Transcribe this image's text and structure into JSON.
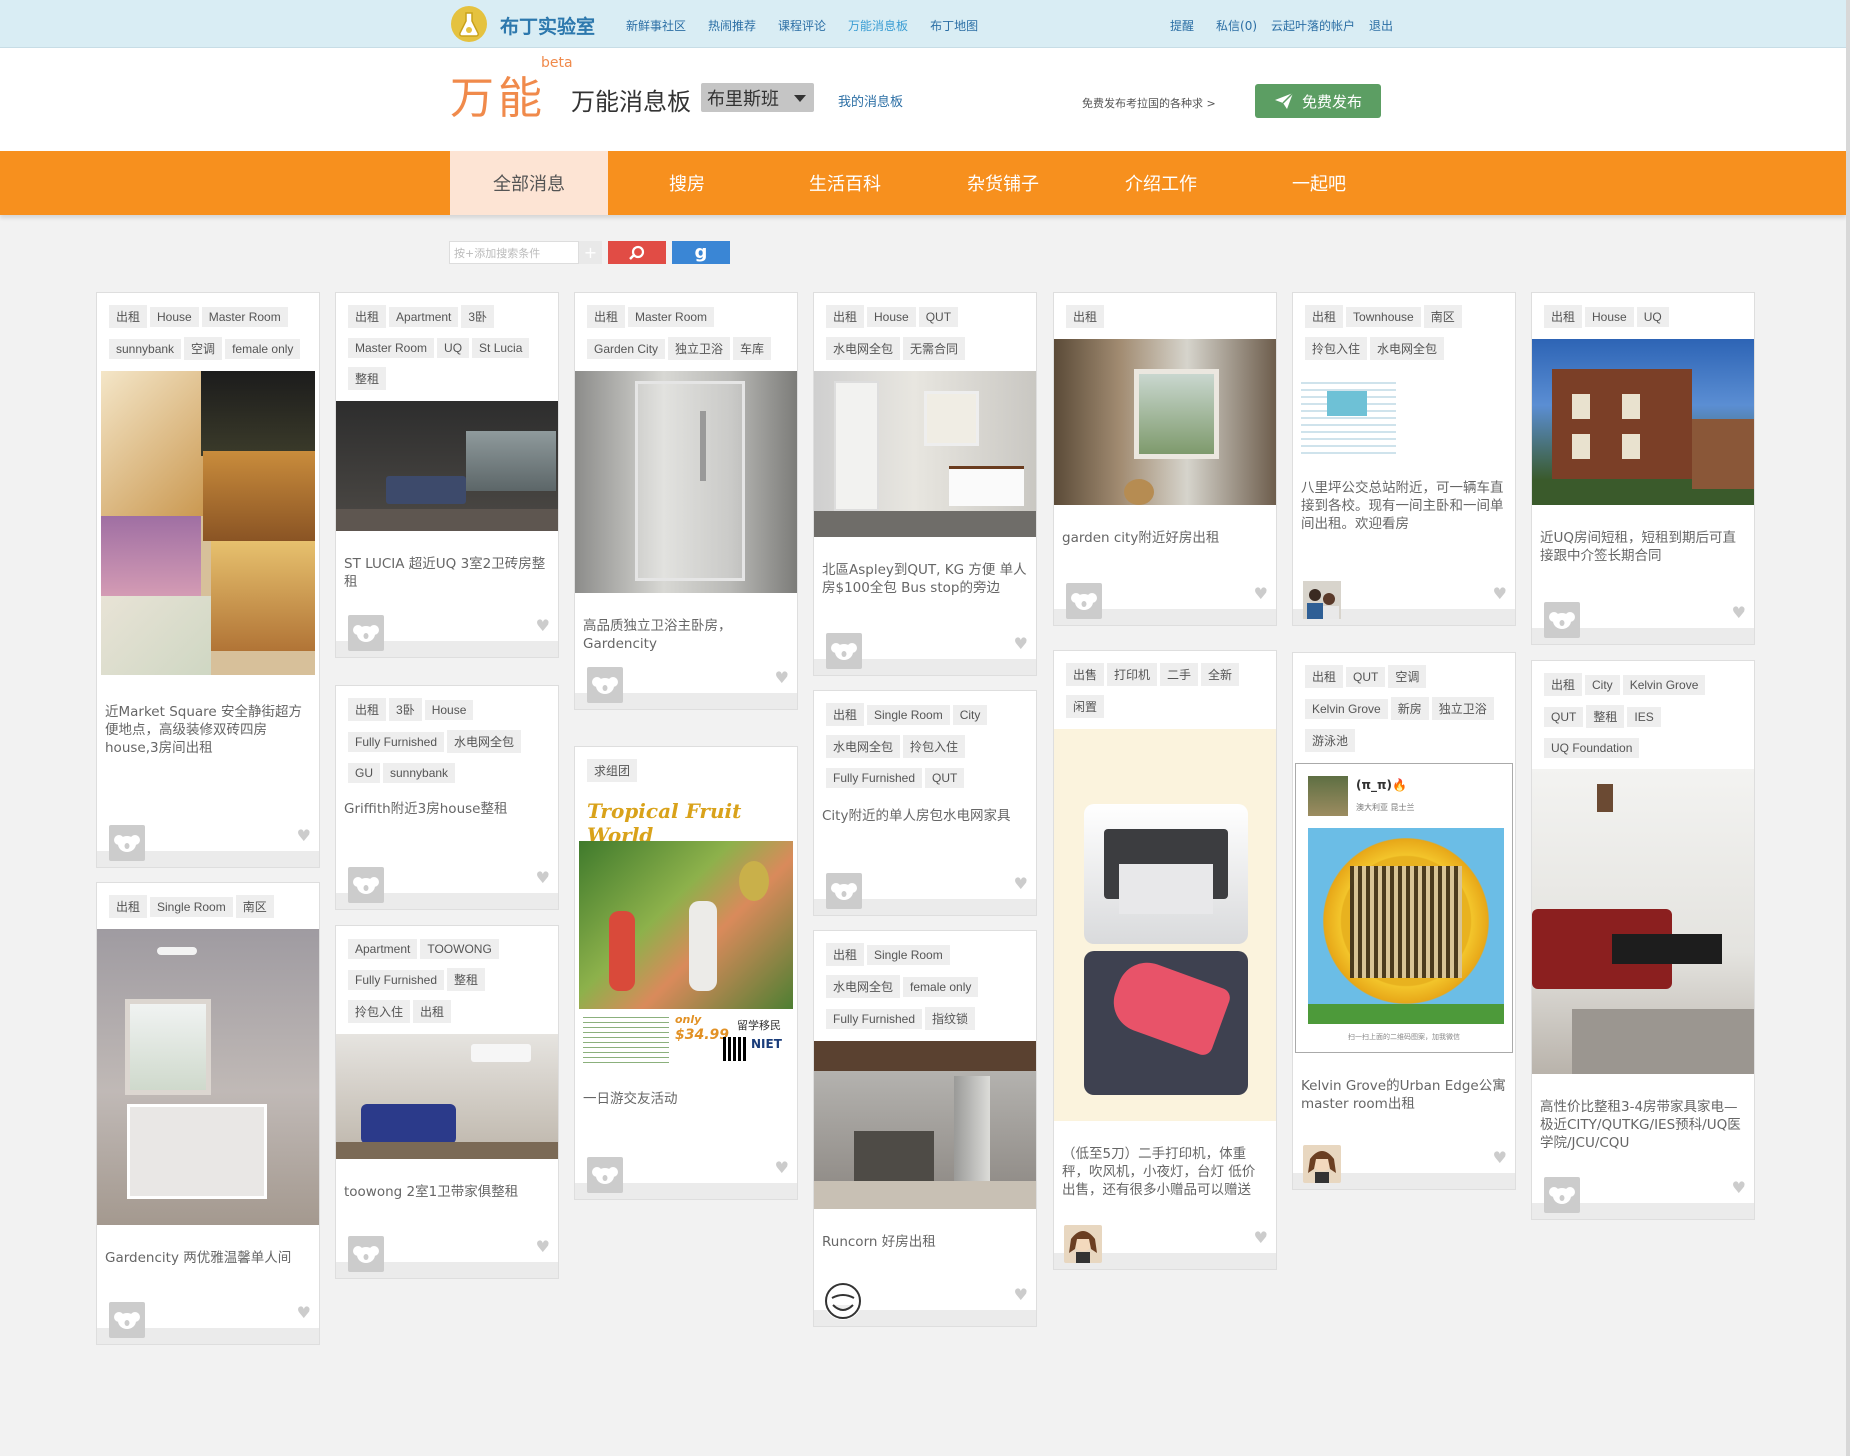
{
  "top": {
    "logo": "布丁实验室",
    "nav": [
      "新鲜事社区",
      "热闹推荐",
      "课程评论",
      "万能消息板",
      "布丁地图"
    ],
    "active_nav": 3,
    "right": [
      "提醒",
      "私信(0)",
      "云起叶落的帐户",
      "退出"
    ]
  },
  "header": {
    "brand": "万能",
    "beta": "beta",
    "title": "万能消息板",
    "city": "布里斯班",
    "my_board": "我的消息板",
    "promo": "免费发布考拉国的各种求 >",
    "publish": "免费发布"
  },
  "tabs": [
    "全部消息",
    "搜房",
    "生活百科",
    "杂货铺子",
    "介绍工作",
    "一起吧"
  ],
  "search": {
    "placeholder": "按+添加搜索条件",
    "plus": "+",
    "google": "g"
  },
  "cards": [
    {
      "tags": [
        "出租",
        "House",
        "Master Room",
        "sunnybank",
        "空调",
        "female only"
      ],
      "desc": "近Market Square 安全静街超方便地点，高级装修双砖四房house,3房间出租"
    },
    {
      "tags": [
        "出租",
        "Single Room",
        "南区"
      ],
      "desc": "Gardencity 两优雅温馨单人间"
    },
    {
      "tags": [
        "出租",
        "Apartment",
        "3卧",
        "Master Room",
        "UQ",
        "St Lucia",
        "整租"
      ],
      "desc": "ST LUCIA 超近UQ 3室2卫砖房整租"
    },
    {
      "tags": [
        "出租",
        "3卧",
        "House",
        "Fully Furnished",
        "水电网全包",
        "GU",
        "sunnybank"
      ],
      "desc": "Griffith附近3房house整租"
    },
    {
      "tags": [
        "Apartment",
        "TOOWONG",
        "Fully Furnished",
        "整租",
        "拎包入住",
        "出租"
      ],
      "desc": "toowong 2室1卫带家俱整租"
    },
    {
      "tags": [
        "出租",
        "Master Room",
        "Garden City",
        "独立卫浴",
        "车库"
      ],
      "desc": "高品质独立卫浴主卧房，Gardencity"
    },
    {
      "tags": [
        "求组团"
      ],
      "desc": "一日游交友活动",
      "poster": "Tropical Fruit World",
      "price": "$34.99",
      "only": "only",
      "org": "留学移民",
      "niet": "NIET"
    },
    {
      "tags": [
        "出租",
        "House",
        "QUT",
        "水电网全包",
        "无需合同"
      ],
      "desc": "北區Aspley到QUT, KG 方便 单人房$100全包 Bus stop的旁边"
    },
    {
      "tags": [
        "出租",
        "Single Room",
        "City",
        "水电网全包",
        "拎包入住",
        "Fully Furnished",
        "QUT"
      ],
      "desc": "City附近的单人房包水电网家具"
    },
    {
      "tags": [
        "出租",
        "Single Room",
        "水电网全包",
        "female only",
        "Fully Furnished",
        "指纹锁"
      ],
      "desc": "Runcorn 好房出租"
    },
    {
      "tags": [
        "出租"
      ],
      "desc": "garden city附近好房出租"
    },
    {
      "tags": [
        "出售",
        "打印机",
        "二手",
        "全新",
        "闲置"
      ],
      "desc": "（低至5刀）二手打印机，体重秤，吹风机，小夜灯，台灯 低价出售，还有很多小赠品可以赠送"
    },
    {
      "tags": [
        "出租",
        "Townhouse",
        "南区",
        "拎包入住",
        "水电网全包"
      ],
      "desc": "八里坪公交总站附近，可一辆车直接到各校。现有一间主卧和一间单间出租。欢迎看房"
    },
    {
      "tags": [
        "出租",
        "QUT",
        "空调",
        "Kelvin Grove",
        "新房",
        "独立卫浴",
        "游泳池"
      ],
      "desc": "Kelvin Grove的Urban Edge公寓master room出租",
      "qr_name": "(π_π)🔥",
      "qr_loc": "澳大利亚 昆士兰",
      "qr_note": "扫一扫上面的二维码图案，加我微信"
    },
    {
      "tags": [
        "出租",
        "House",
        "UQ"
      ],
      "desc": "近UQ房间短租，短租到期后可直接跟中介签长期合同"
    },
    {
      "tags": [
        "出租",
        "City",
        "Kelvin Grove",
        "QUT",
        "整租",
        "IES",
        "UQ Foundation"
      ],
      "desc": "高性价比整租3-4房带家具家电—极近CITY/QUTKG/IES预科/UQ医学院/JCU/CQU"
    }
  ],
  "colors": {
    "orange": "#f7901e",
    "topbar": "#d9edf4",
    "green": "#5c9e63",
    "red": "#e14c45",
    "blue": "#3a86d5"
  }
}
